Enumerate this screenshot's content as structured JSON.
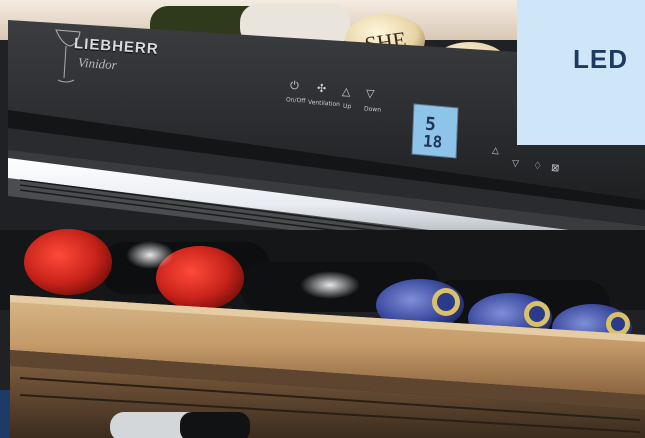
{
  "badge": {
    "text": "LED",
    "bg": "#cfe5f8",
    "fg": "#1f3a5f"
  },
  "panel": {
    "brand": "LIEBHERR",
    "model": "Vinidor",
    "buttons": [
      {
        "name": "power-icon",
        "glyph": "⏻",
        "label": "On/Off"
      },
      {
        "name": "fan-icon",
        "glyph": "✣",
        "label": "Ventilation"
      },
      {
        "name": "up-icon",
        "glyph": "△",
        "label": "Up"
      },
      {
        "name": "down-icon",
        "glyph": "▽",
        "label": "Down"
      }
    ],
    "display": {
      "top": "5",
      "bottom": "18"
    },
    "right_buttons": [
      {
        "name": "up-icon",
        "glyph": "△"
      },
      {
        "name": "down-icon",
        "glyph": "▽"
      },
      {
        "name": "light-icon",
        "glyph": "♢"
      },
      {
        "name": "lock-icon",
        "glyph": "⊠"
      }
    ]
  }
}
